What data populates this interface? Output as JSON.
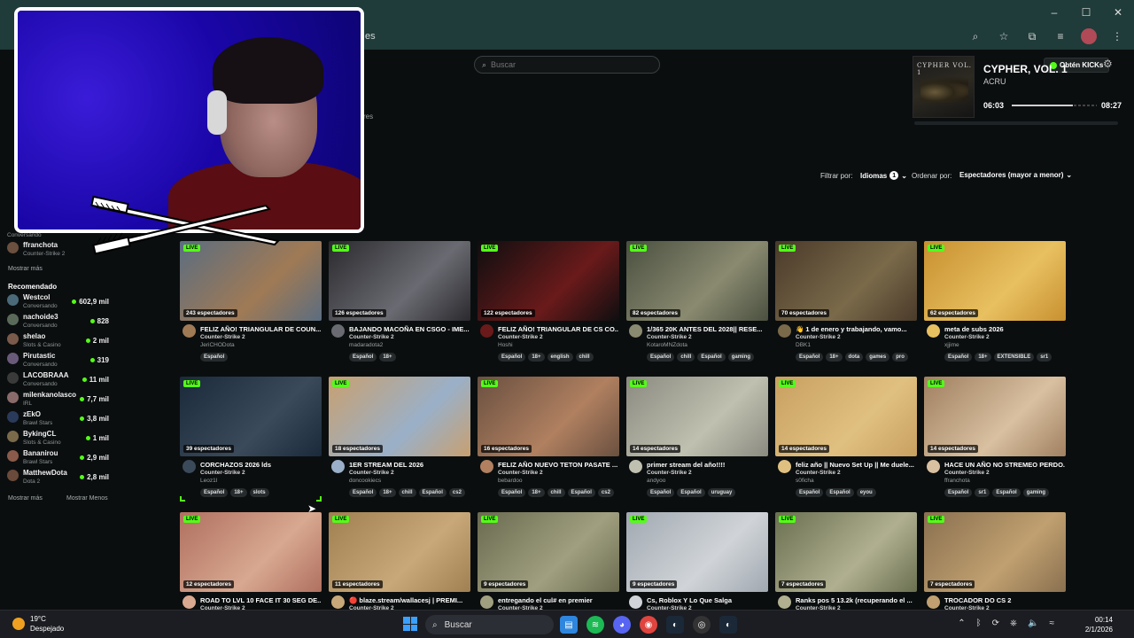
{
  "browser": {
    "url_fragment": "es",
    "window_controls": [
      "–",
      "☐",
      "✕"
    ]
  },
  "page": {
    "search_placeholder": "Buscar",
    "kick_button": "Obtén KICKs",
    "fragment_text": "res"
  },
  "music": {
    "album_text": "CYPHER VOL. 1",
    "title": "CYPHER, VOL. 1",
    "artist": "ACRU",
    "elapsed": "06:03",
    "total": "08:27",
    "progress": 0.72
  },
  "filters": {
    "filter_label": "Filtrar por:",
    "languages_label": "Idiomas",
    "languages_count": "1",
    "order_label": "Ordenar por:",
    "order_value": "Espectadores (mayor a menor)"
  },
  "sidebar": {
    "top_users": [
      {
        "cat": "Conversando"
      },
      {
        "name": "ffranchota",
        "cat": "Counter-Strike 2"
      }
    ],
    "show_more_1": "Mostrar más",
    "recommended_header": "Recomendado",
    "recommended": [
      {
        "name": "Westcol",
        "cat": "Conversando",
        "count": "602,9 mil",
        "color": "#4a6a7a"
      },
      {
        "name": "nachoide3",
        "cat": "Conversando",
        "count": "828",
        "color": "#5a6a5a"
      },
      {
        "name": "shelao",
        "cat": "Slots & Casino",
        "count": "2 mil",
        "color": "#7a5a4a"
      },
      {
        "name": "Pirutastic",
        "cat": "Conversando",
        "count": "319",
        "color": "#6a5a7a"
      },
      {
        "name": "LACOBRAAA",
        "cat": "Conversando",
        "count": "11 mil",
        "color": "#3a3a3a"
      },
      {
        "name": "milenkanolasco",
        "cat": "IRL",
        "count": "7,7 mil",
        "color": "#8a6a6a"
      },
      {
        "name": "zEkO",
        "cat": "Brawl Stars",
        "count": "3,8 mil",
        "color": "#2a3a5a"
      },
      {
        "name": "BykingCL",
        "cat": "Slots & Casino",
        "count": "1 mil",
        "color": "#7a6a4a"
      },
      {
        "name": "Bananirou",
        "cat": "Brawl Stars",
        "count": "2,9 mil",
        "color": "#8a5a4a"
      },
      {
        "name": "MatthewDota",
        "cat": "Dota 2",
        "count": "2,8 mil",
        "color": "#6a4a3a"
      }
    ],
    "show_more_2": "Mostrar más",
    "show_less": "Mostrar Menos"
  },
  "streams": [
    {
      "viewers": "243 espectadores",
      "title": "FELIZ AÑO! TRIANGULAR DE COUN...",
      "cat": "Counter-Strike 2",
      "user": "JeriCHODota",
      "tags": [
        "Español"
      ],
      "thumb": "#5b6d80",
      "thumb2": "#a07a55"
    },
    {
      "viewers": "126 espectadores",
      "title": "BAJANDO MACOÑA EN CSGO - IME...",
      "cat": "Counter-Strike 2",
      "user": "madaradota2",
      "tags": [
        "Español",
        "18+"
      ],
      "thumb": "#2a2a2e",
      "thumb2": "#6a6a72"
    },
    {
      "viewers": "122 espectadores",
      "title": "FELIZ AÑO! TRIANGULAR DE CS CO...",
      "cat": "Counter-Strike 2",
      "user": "Hoshi",
      "tags": [
        "Español",
        "18+",
        "english",
        "chill"
      ],
      "thumb": "#0e0e10",
      "thumb2": "#6a1a1a"
    },
    {
      "viewers": "82 espectadores",
      "title": "1/365 20K ANTES DEL 2028|| RESE...",
      "cat": "Counter-Strike 2",
      "user": "KotaroMNZdota",
      "tags": [
        "Español",
        "chill",
        "Español",
        "gaming"
      ],
      "thumb": "#4a5040",
      "thumb2": "#8a8a70"
    },
    {
      "viewers": "70 espectadores",
      "title": "👋 1 de enero y trabajando, vamo...",
      "cat": "Counter-Strike 2",
      "user": "DBK1",
      "tags": [
        "Español",
        "18+",
        "dota",
        "games",
        "pro"
      ],
      "thumb": "#4a3a2a",
      "thumb2": "#7a6a4a"
    },
    {
      "viewers": "62 espectadores",
      "title": "meta de subs 2026",
      "cat": "Counter-Strike 2",
      "user": "xjjime",
      "tags": [
        "Español",
        "18+",
        "EXTENSIBLE",
        "sr1"
      ],
      "thumb": "#c89030",
      "thumb2": "#e8c060"
    },
    {
      "viewers": "39 espectadores",
      "title": "CORCHAZOS 2026 lds",
      "cat": "Counter-Strike 2",
      "user": "Leoz1l",
      "tags": [
        "Español",
        "18+",
        "slots"
      ],
      "thumb": "#1a2a3a",
      "thumb2": "#3a4a5a"
    },
    {
      "viewers": "18 espectadores",
      "title": "1ER STREAM DEL 2026",
      "cat": "Counter-Strike 2",
      "user": "doncookiecs",
      "tags": [
        "Español",
        "18+",
        "chill",
        "Español",
        "cs2"
      ],
      "thumb": "#c8a070",
      "thumb2": "#9ab0c8"
    },
    {
      "viewers": "16 espectadores",
      "title": "FELIZ AÑO NUEVO TETON PASATE ...",
      "cat": "Counter-Strike 2",
      "user": "bebardoo",
      "tags": [
        "Español",
        "18+",
        "chill",
        "Español",
        "cs2"
      ],
      "thumb": "#6a5040",
      "thumb2": "#b08060"
    },
    {
      "viewers": "14 espectadores",
      "title": "primer stream del año!!!!",
      "cat": "Counter-Strike 2",
      "user": "andyoo",
      "tags": [
        "Español",
        "Español",
        "uruguay"
      ],
      "thumb": "#8a8a80",
      "thumb2": "#c0c0b0"
    },
    {
      "viewers": "14 espectadores",
      "title": "feliz año || Nuevo Set Up || Me duele...",
      "cat": "Counter-Strike 2",
      "user": "s0ficha",
      "tags": [
        "Español",
        "Español",
        "eyou"
      ],
      "thumb": "#c8a060",
      "thumb2": "#e0c080"
    },
    {
      "viewers": "14 espectadores",
      "title": "HACE UN AÑO NO STREMEO PERDO...",
      "cat": "Counter-Strike 2",
      "user": "ffranchota",
      "tags": [
        "Español",
        "sr1",
        "Español",
        "gaming"
      ],
      "thumb": "#a08060",
      "thumb2": "#d8c0a0"
    },
    {
      "viewers": "12 espectadores",
      "title": "ROAD TO LVL 10 FACE IT 30 SEG DE...",
      "cat": "Counter-Strike 2",
      "user": "",
      "tags": [],
      "thumb": "#b07060",
      "thumb2": "#d8a890"
    },
    {
      "viewers": "11 espectadores",
      "title": "🔴 blaze.stream/wallacesj | PREMI...",
      "cat": "Counter-Strike 2",
      "user": "",
      "tags": [],
      "thumb": "#a08050",
      "thumb2": "#c8a878"
    },
    {
      "viewers": "9 espectadores",
      "title": "entregando el cul# en premier",
      "cat": "Counter-Strike 2",
      "user": "",
      "tags": [],
      "thumb": "#6a6a50",
      "thumb2": "#a0a080"
    },
    {
      "viewers": "9 espectadores",
      "title": "Cs, Roblox Y Lo Que Salga",
      "cat": "Counter-Strike 2",
      "user": "",
      "tags": [],
      "thumb": "#a0a8b0",
      "thumb2": "#d0d4d8"
    },
    {
      "viewers": "7 espectadores",
      "title": "Ranks pos 5 13.2k (recuperando el ...",
      "cat": "Counter-Strike 2",
      "user": "",
      "tags": [],
      "thumb": "#6a7050",
      "thumb2": "#b0b090"
    },
    {
      "viewers": "7 espectadores",
      "title": "TROCADOR DO CS 2",
      "cat": "Counter-Strike 2",
      "user": "",
      "tags": [],
      "thumb": "#8a7050",
      "thumb2": "#c0a070"
    }
  ],
  "taskbar": {
    "temp": "19°C",
    "weather": "Despejado",
    "search": "Buscar",
    "time": "00:14",
    "date": "2/1/2026"
  }
}
